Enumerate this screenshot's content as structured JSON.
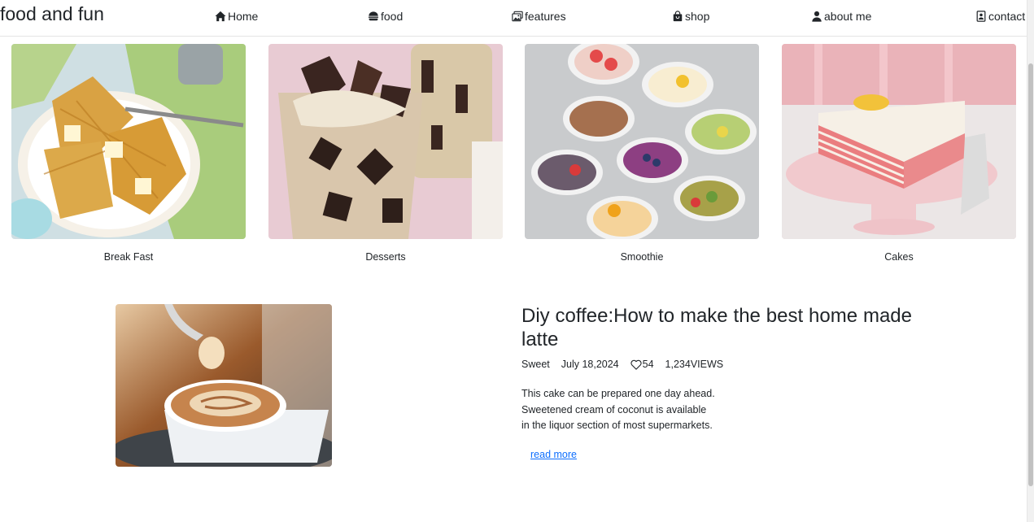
{
  "nav": {
    "brand": "food and fun",
    "items": [
      {
        "label": "Home",
        "icon": "home-icon"
      },
      {
        "label": "food",
        "icon": "food-icon"
      },
      {
        "label": "features",
        "icon": "images-icon"
      },
      {
        "label": "shop",
        "icon": "shopping-bag-icon"
      },
      {
        "label": "about me",
        "icon": "person-icon"
      },
      {
        "label": "contact",
        "icon": "contact-card-icon"
      }
    ]
  },
  "categories": [
    {
      "title": "Break Fast"
    },
    {
      "title": "Desserts"
    },
    {
      "title": "Smoothie"
    },
    {
      "title": "Cakes"
    }
  ],
  "post": {
    "title": "Diy coffee:How to make the best home made latte",
    "author": "Sweet",
    "date": "July 18,2024",
    "likes": "54",
    "views": "1,234VIEWS",
    "description_lines": [
      "This cake can be prepared one day ahead.",
      "Sweetened cream of coconut is available",
      "in the liquor section of most supermarkets."
    ],
    "read_more": "read more"
  },
  "colors": {
    "link": "#0d6efd",
    "text": "#212529"
  }
}
